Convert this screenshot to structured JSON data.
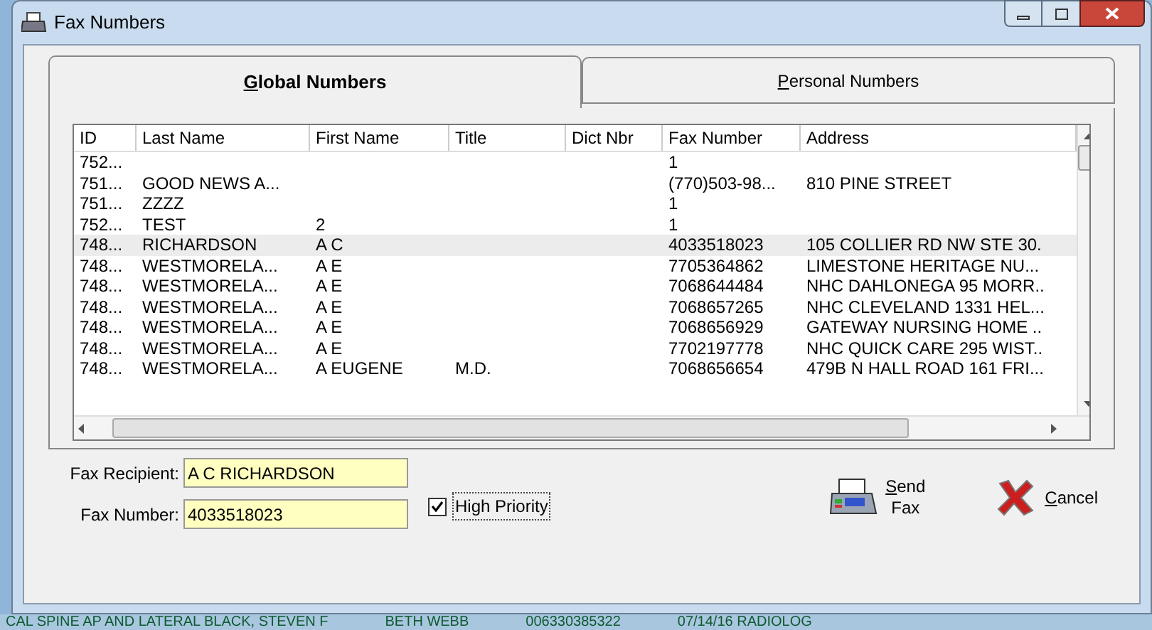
{
  "window": {
    "title": "Fax Numbers"
  },
  "tabs": [
    {
      "label": "Global Numbers",
      "selected": true
    },
    {
      "label": "Personal Numbers",
      "selected": false
    }
  ],
  "table": {
    "columns": [
      "ID",
      "Last Name",
      "First Name",
      "Title",
      "Dict Nbr",
      "Fax Number",
      "Address"
    ],
    "rows": [
      {
        "cells": [
          "752...",
          "",
          "",
          "",
          "",
          "1",
          ""
        ],
        "selected": false
      },
      {
        "cells": [
          "751...",
          "GOOD NEWS A...",
          "",
          "",
          "",
          "(770)503-98...",
          "810 PINE STREET"
        ],
        "selected": false
      },
      {
        "cells": [
          "751...",
          "ZZZZ",
          "",
          "",
          "",
          "1",
          ""
        ],
        "selected": false
      },
      {
        "cells": [
          "752...",
          "TEST",
          "2",
          "",
          "",
          "1",
          ""
        ],
        "selected": false
      },
      {
        "cells": [
          "748...",
          "RICHARDSON",
          "A C",
          "",
          "",
          "4033518023",
          "105 COLLIER RD NW STE 30."
        ],
        "selected": true
      },
      {
        "cells": [
          "748...",
          "WESTMORELA...",
          "A E",
          "",
          "",
          "7705364862",
          "LIMESTONE HERITAGE NU..."
        ],
        "selected": false
      },
      {
        "cells": [
          "748...",
          "WESTMORELA...",
          "A E",
          "",
          "",
          "7068644484",
          "NHC DAHLONEGA 95 MORR.."
        ],
        "selected": false
      },
      {
        "cells": [
          "748...",
          "WESTMORELA...",
          "A E",
          "",
          "",
          "7068657265",
          "NHC CLEVELAND 1331 HEL..."
        ],
        "selected": false
      },
      {
        "cells": [
          "748...",
          "WESTMORELA...",
          "A E",
          "",
          "",
          "7068656929",
          "GATEWAY NURSING HOME .."
        ],
        "selected": false
      },
      {
        "cells": [
          "748...",
          "WESTMORELA...",
          "A E",
          "",
          "",
          "7702197778",
          "NHC QUICK CARE 295 WIST.."
        ],
        "selected": false
      },
      {
        "cells": [
          "748...",
          "WESTMORELA...",
          "A EUGENE",
          "M.D.",
          "",
          "7068656654",
          "479B N HALL ROAD 161 FRI..."
        ],
        "selected": false
      }
    ]
  },
  "form": {
    "recipient_label": "Fax Recipient:",
    "recipient": "A C RICHARDSON",
    "number_label": "Fax Number:",
    "number": "4033518023",
    "high_priority": {
      "label": "High Priority",
      "checked": true
    }
  },
  "buttons": [
    {
      "kind": "send",
      "label": "Send Fax"
    },
    {
      "kind": "cancel",
      "label": "Cancel"
    }
  ],
  "background_strip": [
    "CAL SPINE AP AND LATERAL BLACK, STEVEN F",
    "BETH WEBB",
    "006330385322",
    "07/14/16 RADIOLOG"
  ]
}
